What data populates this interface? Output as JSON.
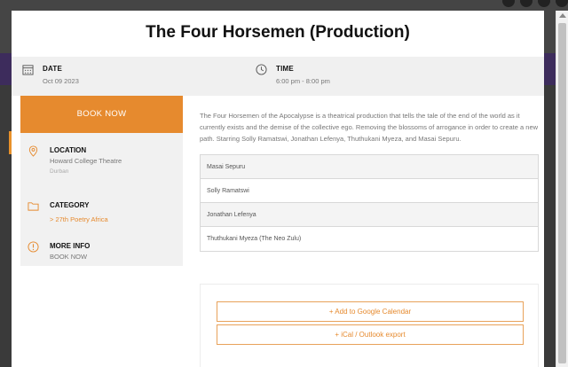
{
  "event": {
    "title": "The Four Horsemen (Production)",
    "date_label": "DATE",
    "date_value": "Oct 09 2023",
    "time_label": "TIME",
    "time_value": "6:00 pm - 8:00 pm",
    "book_label": "BOOK NOW",
    "location_label": "LOCATION",
    "location_name": "Howard College Theatre",
    "location_city": "Durban",
    "category_label": "CATEGORY",
    "category_value": "> 27th Poetry Africa",
    "moreinfo_label": "MORE INFO",
    "moreinfo_value": "BOOK NOW",
    "description": "The Four Horsemen of the Apocalypse is a theatrical production that tells the tale of the end of the world as it currently exists and the demise of the collective ego. Removing the blossoms of arrogance in order to create a new path. Starring Solly Ramatswi, Jonathan Lefenya, Thuthukani Myeza, and Masai Sepuru.",
    "cast": [
      "Masai Sepuru",
      "Solly Ramatswi",
      "Jonathan Lefenya",
      "Thuthukani Myeza (The Neo Zulu)"
    ],
    "google_cal_label": "+ Add to Google Calendar",
    "ical_label": "+ iCal / Outlook export"
  },
  "colors": {
    "accent": "#e68a2e",
    "meta_bg": "#f0f0f0",
    "backdrop": "#3a3a3a"
  },
  "icons": [
    "calendar-icon",
    "clock-icon",
    "location-pin-icon",
    "folder-icon",
    "info-icon"
  ]
}
